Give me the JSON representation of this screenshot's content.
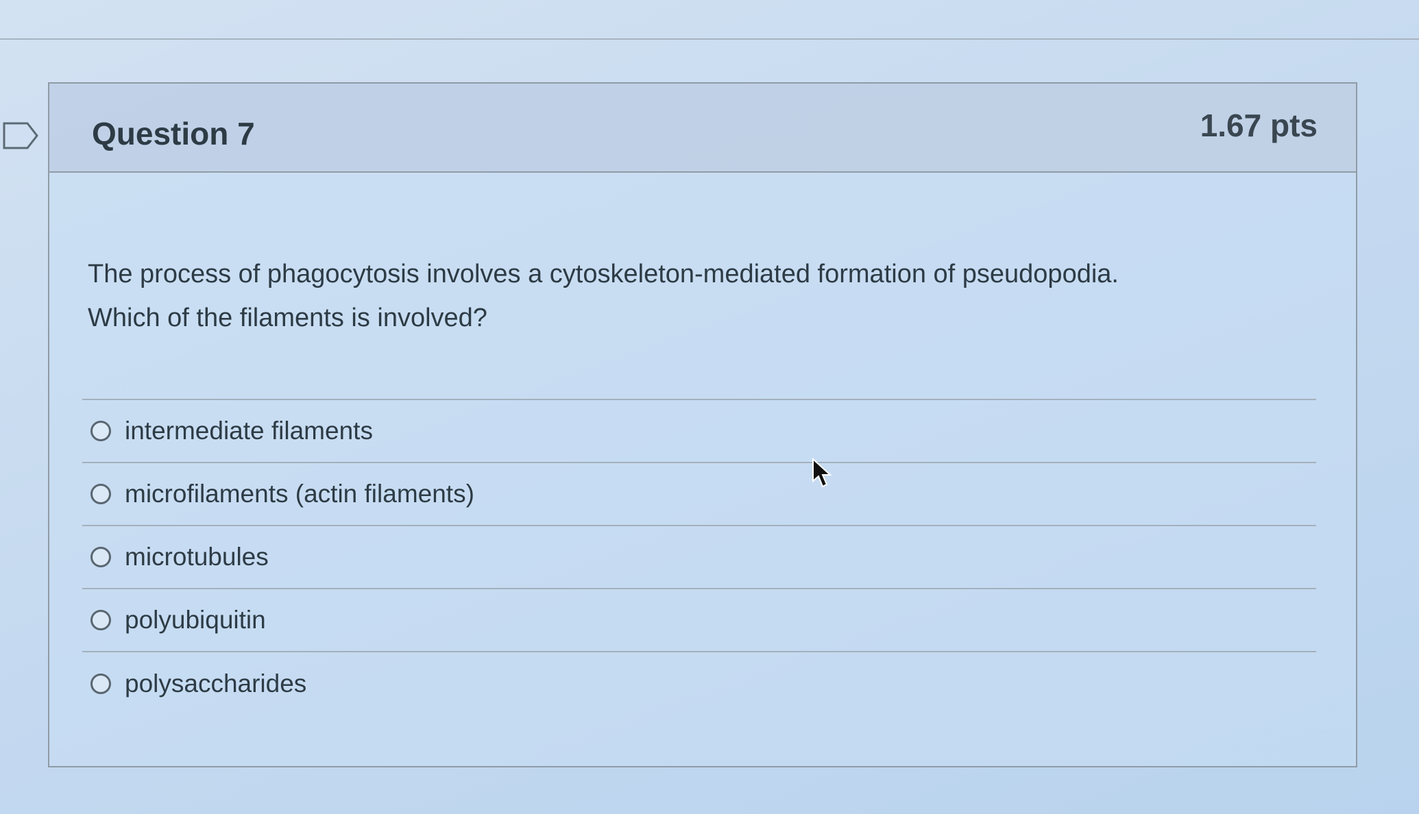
{
  "question": {
    "title": "Question 7",
    "points": "1.67 pts",
    "text_line1": "The process of phagocytosis involves a cytoskeleton-mediated formation of pseudopodia.",
    "text_line2": "Which of the filaments is involved?",
    "flag_icon": "flag-outline-icon"
  },
  "answers": [
    {
      "label": "intermediate filaments"
    },
    {
      "label": "microfilaments (actin filaments)"
    },
    {
      "label": "microtubules"
    },
    {
      "label": "polyubiquitin"
    },
    {
      "label": "polysaccharides"
    }
  ],
  "colors": {
    "background": "#c6daf0",
    "border": "#8f9ba6",
    "text": "#2d3b45"
  }
}
